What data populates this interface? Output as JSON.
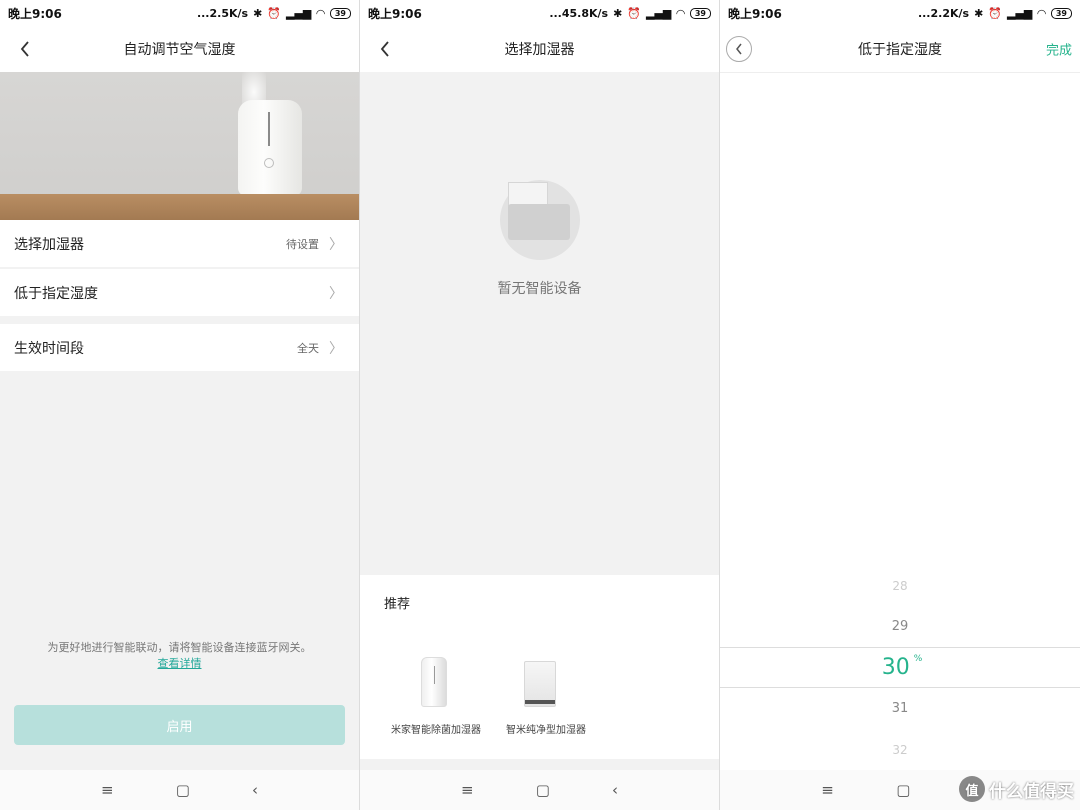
{
  "screens": [
    {
      "status": {
        "time": "晚上9:06",
        "speed": "...2.5K/s",
        "battery": "39"
      },
      "nav": {
        "title": "自动调节空气湿度"
      },
      "rows": [
        {
          "label": "选择加湿器",
          "value": "待设置"
        },
        {
          "label": "低于指定湿度",
          "value": ""
        },
        {
          "label": "生效时间段",
          "value": "全天"
        }
      ],
      "note": {
        "text": "为更好地进行智能联动，请将智能设备连接蓝牙网关。",
        "link": "查看详情"
      },
      "enable_label": "启用"
    },
    {
      "status": {
        "time": "晚上9:06",
        "speed": "...45.8K/s",
        "battery": "39"
      },
      "nav": {
        "title": "选择加湿器"
      },
      "empty_text": "暂无智能设备",
      "recommend": {
        "title": "推荐",
        "items": [
          {
            "name": "米家智能除菌加湿器"
          },
          {
            "name": "智米纯净型加湿器"
          }
        ]
      }
    },
    {
      "status": {
        "time": "晚上9:06",
        "speed": "...2.2K/s",
        "battery": "39"
      },
      "nav": {
        "title": "低于指定湿度",
        "done": "完成"
      },
      "picker": {
        "values": [
          "28",
          "29",
          "30",
          "31",
          "32"
        ],
        "selected": "30",
        "unit": "%"
      }
    }
  ],
  "sysnav": {
    "menu": "≡",
    "home": "▢",
    "back": "‹"
  },
  "watermark": {
    "logo": "值",
    "text": "什么值得买"
  }
}
